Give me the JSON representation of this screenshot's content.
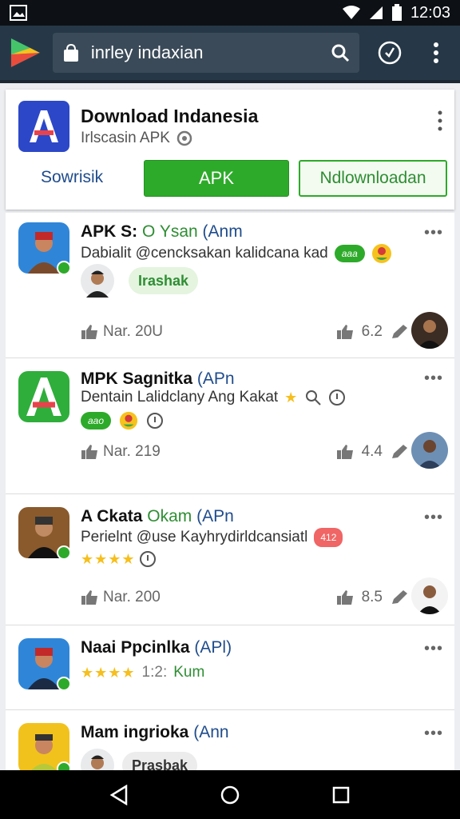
{
  "status": {
    "time": "12:03"
  },
  "toolbar": {
    "url": "inrley indaxian"
  },
  "hero": {
    "title": "Download Indanesia",
    "subtitle": "Irlscasin APK",
    "link": "Sowrisik",
    "apk_button": "APK",
    "download_button": "Ndlownloadan"
  },
  "items": [
    {
      "title_main": "APK S:",
      "title_green": "O Ysan",
      "title_tag": "(Anm",
      "desc": "Dabialit @cencksakan kalidcana kad",
      "chip": "aaa",
      "pill": "Irashak",
      "stat_left": "Nar. 20U",
      "rating": "6.2",
      "more": "•••"
    },
    {
      "title_main": "MPK Sagnitka",
      "title_tag": "(APn",
      "desc": "Dentain Lalidclany Ang Kakat",
      "chip": "aao",
      "stat_left": "Nar. 219",
      "rating": "4.4",
      "more": "•••"
    },
    {
      "title_main": "A Ckata",
      "title_green": "Okam",
      "title_tag": "(APn",
      "desc": "Perielnt @use Kayhrydirldcansiatl",
      "chip": "412",
      "stars": "★★★★",
      "stat_left": "Nar. 200",
      "rating": "8.5",
      "more": "•••"
    },
    {
      "title_main": "Naai Ppcinlka",
      "title_tag": "(APl)",
      "stars": "★★★★",
      "stars_text": "1:2:",
      "stars_green": "Kum",
      "more": "•••"
    },
    {
      "title_main": "Mam ingrioka",
      "title_tag": "(Ann",
      "pill": "Prasbak",
      "more": "•••"
    }
  ],
  "colors": {
    "accent_green": "#2eaa2a",
    "toolbar": "#263847",
    "link_blue": "#1f4c8c"
  }
}
